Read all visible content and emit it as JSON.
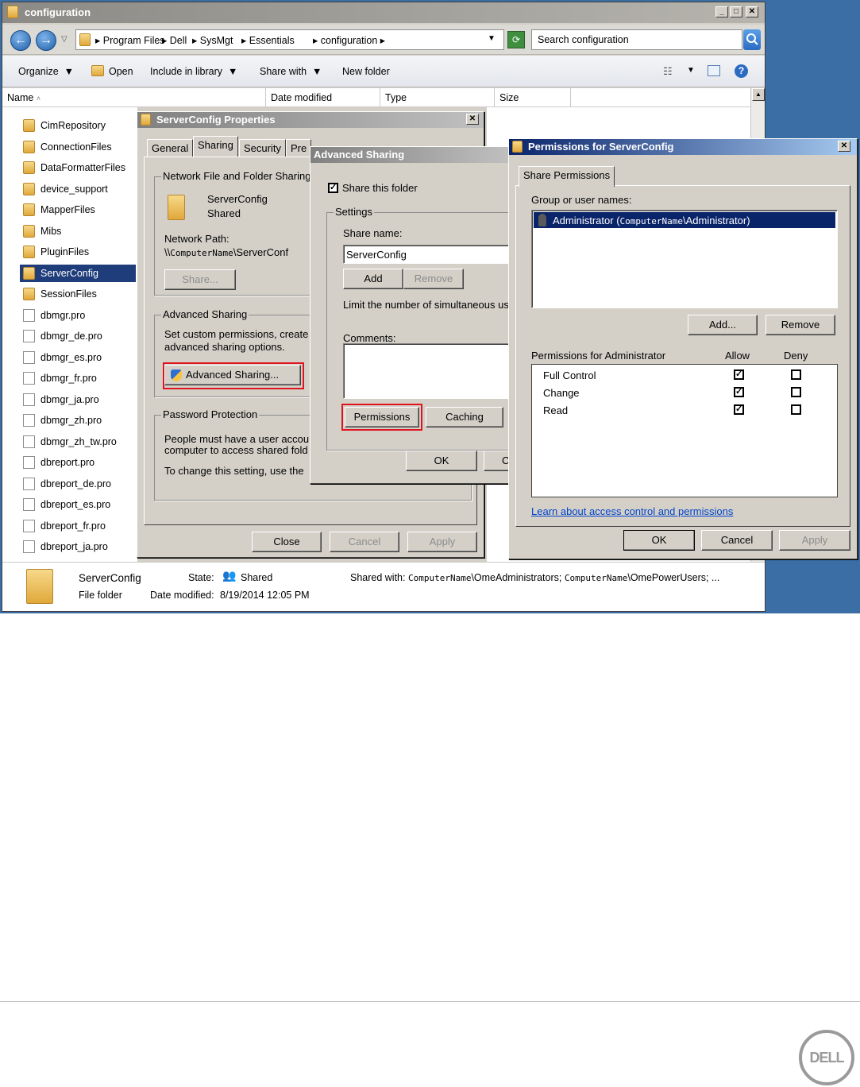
{
  "explorer": {
    "title": "configuration",
    "breadcrumbs": [
      "Program Files",
      "Dell",
      "SysMgt",
      "Essentials",
      "configuration"
    ],
    "search_placeholder": "Search configuration",
    "toolbar": {
      "organize": "Organize",
      "open": "Open",
      "include_in_library": "Include in library",
      "share_with": "Share with",
      "new_folder": "New folder"
    },
    "columns": [
      "Name",
      "Date modified",
      "Type",
      "Size"
    ],
    "files": [
      {
        "name": "CimRepository",
        "kind": "folder"
      },
      {
        "name": "ConnectionFiles",
        "kind": "folder"
      },
      {
        "name": "DataFormatterFiles",
        "kind": "folder"
      },
      {
        "name": "device_support",
        "kind": "folder"
      },
      {
        "name": "MapperFiles",
        "kind": "folder"
      },
      {
        "name": "Mibs",
        "kind": "folder"
      },
      {
        "name": "PluginFiles",
        "kind": "folder"
      },
      {
        "name": "ServerConfig",
        "kind": "folder"
      },
      {
        "name": "SessionFiles",
        "kind": "folder"
      },
      {
        "name": "dbmgr.pro",
        "kind": "file"
      },
      {
        "name": "dbmgr_de.pro",
        "kind": "file"
      },
      {
        "name": "dbmgr_es.pro",
        "kind": "file"
      },
      {
        "name": "dbmgr_fr.pro",
        "kind": "file"
      },
      {
        "name": "dbmgr_ja.pro",
        "kind": "file"
      },
      {
        "name": "dbmgr_zh.pro",
        "kind": "file"
      },
      {
        "name": "dbmgr_zh_tw.pro",
        "kind": "file"
      },
      {
        "name": "dbreport.pro",
        "kind": "file"
      },
      {
        "name": "dbreport_de.pro",
        "kind": "file"
      },
      {
        "name": "dbreport_es.pro",
        "kind": "file"
      },
      {
        "name": "dbreport_fr.pro",
        "kind": "file"
      },
      {
        "name": "dbreport_ja.pro",
        "kind": "file"
      }
    ],
    "details": {
      "name": "ServerConfig",
      "type": "File folder",
      "state_label": "State:",
      "state_value": "Shared",
      "date_label": "Date modified:",
      "date_value": "8/19/2014 12:05 PM",
      "shared_with_label": "Shared with:",
      "shared_with_computer1": "ComputerName",
      "shared_with_group1": "\\OmeAdministrators;",
      "shared_with_computer2": "ComputerName",
      "shared_with_group2": "\\OmePowerUsers; ..."
    }
  },
  "properties_dialog": {
    "title": "ServerConfig Properties",
    "tabs": [
      "General",
      "Sharing",
      "Security",
      "Pre"
    ],
    "network_group": "Network File and Folder Sharing",
    "folder_name": "ServerConfig",
    "folder_state": "Shared",
    "network_path_label": "Network Path:",
    "network_path_prefix": "\\\\",
    "network_path_computer": "ComputerName",
    "network_path_suffix": "\\ServerConf",
    "share_button": "Share...",
    "advanced_group": "Advanced Sharing",
    "advanced_desc_1": "Set custom permissions, create",
    "advanced_desc_2": "advanced sharing options.",
    "advanced_button": "Advanced Sharing...",
    "password_group": "Password Protection",
    "password_desc_1": "People must have a user accou",
    "password_desc_2": "computer to access shared fold",
    "password_desc_3": "To change this setting, use the",
    "close": "Close",
    "cancel": "Cancel",
    "apply": "Apply"
  },
  "advanced_dialog": {
    "title": "Advanced Sharing",
    "share_this_folder": "Share this folder",
    "settings_group": "Settings",
    "share_name_label": "Share name:",
    "share_name_value": "ServerConfig",
    "add": "Add",
    "remove": "Remove",
    "limit_text": "Limit the number of simultaneous us",
    "comments_label": "Comments:",
    "permissions": "Permissions",
    "caching": "Caching",
    "ok": "OK",
    "cancel_cut": "C"
  },
  "permissions_dialog": {
    "title": "Permissions for ServerConfig",
    "tab": "Share Permissions",
    "group_label": "Group or user names:",
    "user_name": "Administrator (",
    "user_computer": "ComputerName",
    "user_suffix": "\\Administrator)",
    "add": "Add...",
    "remove": "Remove",
    "permissions_for": "Permissions for Administrator",
    "allow": "Allow",
    "deny": "Deny",
    "rows": [
      {
        "name": "Full Control",
        "allow": true,
        "deny": false
      },
      {
        "name": "Change",
        "allow": true,
        "deny": false
      },
      {
        "name": "Read",
        "allow": true,
        "deny": false
      }
    ],
    "learn_link": "Learn about access control and permissions",
    "ok": "OK",
    "cancel": "Cancel",
    "apply": "Apply"
  },
  "footer": {
    "logo_text": "DELL"
  }
}
